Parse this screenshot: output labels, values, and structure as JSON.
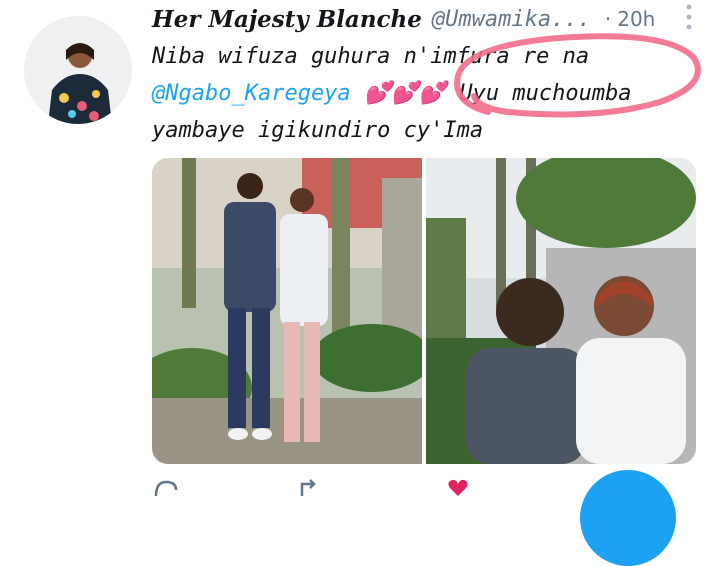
{
  "tweet": {
    "author_name": "Her Majesty Blanche",
    "author_handle": "@Umwamika...",
    "separator": "·",
    "time": "20h",
    "text": {
      "line1": "Niba wifuza guhura n'imfura ",
      "line1_tail": "re na",
      "line2_mention": "@Ngabo_Karegeya",
      "line2_hearts": "💕💕💕",
      "line2_tail": " Uyu muchoumba",
      "line3": "yambaye igikundiro cy'Ima"
    }
  },
  "media": {
    "photo_count": 2
  },
  "colors": {
    "link": "#1da1f2",
    "annotation": "#f26d8a",
    "secondary_text": "#657786"
  },
  "icons": [
    "more-vertical-icon",
    "reply-icon",
    "retweet-icon",
    "like-icon",
    "compose-fab-icon"
  ]
}
